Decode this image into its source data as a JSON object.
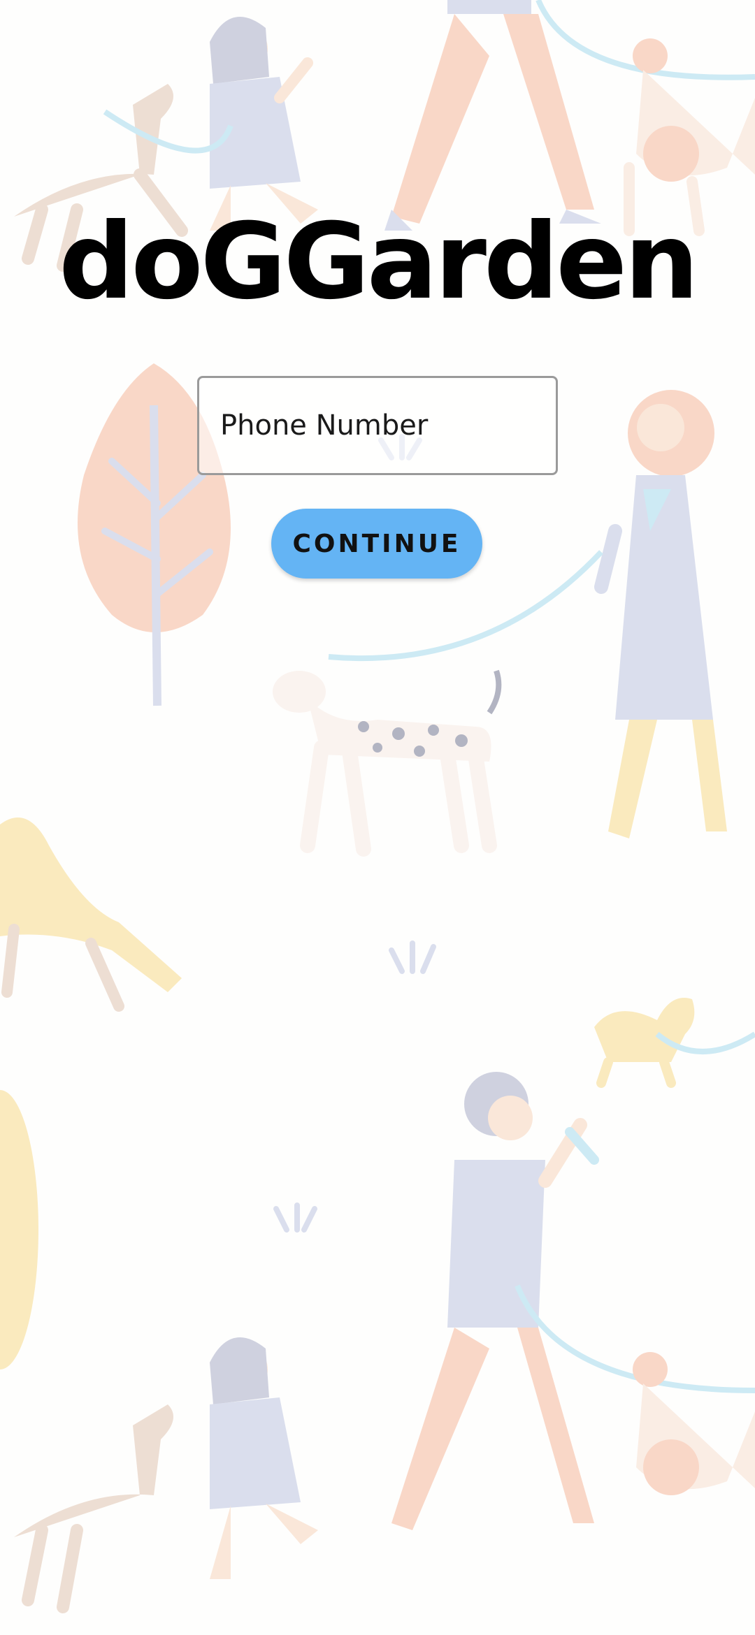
{
  "app": {
    "title": "doGGarden"
  },
  "form": {
    "phone_placeholder": "Phone Number",
    "phone_value": "",
    "continue_label": "CONTINUE"
  },
  "theme": {
    "accent": "#64b4f4",
    "background": "#fefefd",
    "illustration_colors": [
      "#f4a27e",
      "#a9b4d8",
      "#f6cf6a",
      "#8ccfe8",
      "#d8b39a"
    ]
  },
  "background": {
    "illustration": "people-walking-dogs-pattern"
  }
}
